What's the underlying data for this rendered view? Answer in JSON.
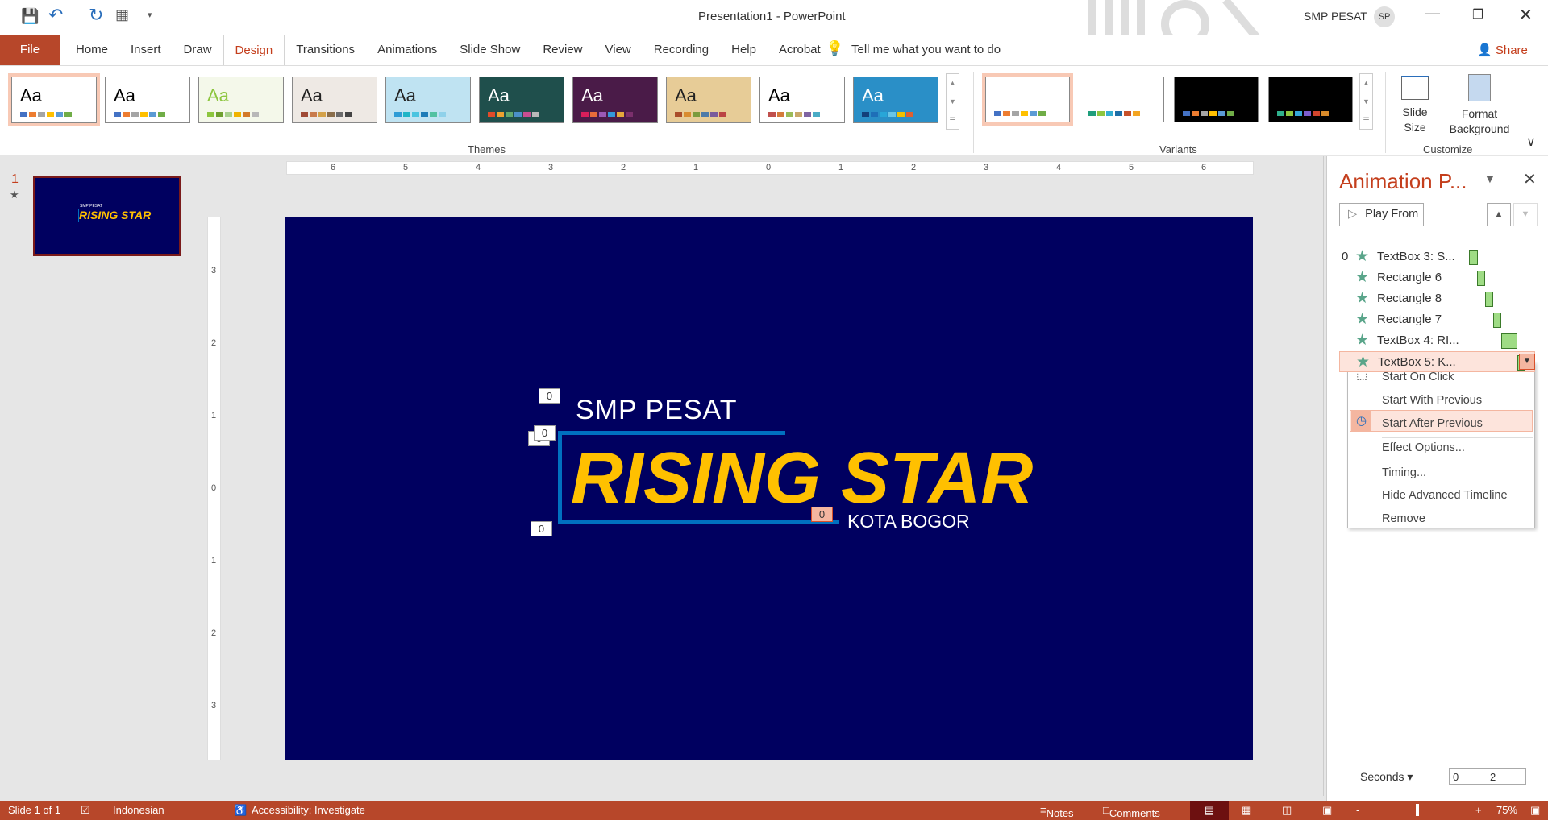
{
  "titlebar": {
    "title": "Presentation1  -  PowerPoint",
    "user": "SMP PESAT",
    "user_initials": "SP",
    "share": "Share"
  },
  "tabs": [
    "File",
    "Home",
    "Insert",
    "Draw",
    "Design",
    "Transitions",
    "Animations",
    "Slide Show",
    "Review",
    "View",
    "Recording",
    "Help",
    "Acrobat"
  ],
  "active_tab": "Design",
  "tell_me": "Tell me what you want to do",
  "ribbon": {
    "themes_label": "Themes",
    "variants_label": "Variants",
    "customize_label": "Customize",
    "theme_sample": "Aa",
    "slide_size": "Slide Size",
    "format_background": "Format Background"
  },
  "themes": [
    {
      "bg": "#ffffff",
      "fg": "#000",
      "sw": [
        "#4472c4",
        "#ed7d31",
        "#a5a5a5",
        "#ffc000",
        "#5b9bd5",
        "#70ad47"
      ]
    },
    {
      "bg": "#ffffff",
      "fg": "#000",
      "sw": [
        "#4472c4",
        "#ed7d31",
        "#a5a5a5",
        "#ffc000",
        "#5b9bd5",
        "#70ad47"
      ]
    },
    {
      "bg": "#f4f8ea",
      "fg": "#8dc63f",
      "sw": [
        "#8dc63f",
        "#6fa030",
        "#a8d08d",
        "#f0b400",
        "#d37a2a",
        "#b8b8b8"
      ]
    },
    {
      "bg": "#eee9e4",
      "fg": "#222",
      "sw": [
        "#a04a36",
        "#c97b4d",
        "#d4a24a",
        "#8a6e4b",
        "#6b6b6b",
        "#444"
      ]
    },
    {
      "bg": "#bfe3f2",
      "fg": "#222",
      "sw": [
        "#2e9cd6",
        "#1fb5c7",
        "#4cc4e0",
        "#1e7cb8",
        "#53c1a2",
        "#8fd1ea"
      ]
    },
    {
      "bg": "#1f4f4c",
      "fg": "#fff",
      "sw": [
        "#e04b2a",
        "#f0a030",
        "#62a66e",
        "#4b8fc9",
        "#c84d91",
        "#b8b8b8"
      ]
    },
    {
      "bg": "#4a1b48",
      "fg": "#fff",
      "sw": [
        "#d81e5b",
        "#e86c3a",
        "#9b59b6",
        "#3498db",
        "#e5a93b",
        "#7b2f6c"
      ]
    },
    {
      "bg": "#e7cc97",
      "fg": "#222",
      "sw": [
        "#a94d2a",
        "#d98c2f",
        "#7b9b3d",
        "#4e7ba8",
        "#7a5b9c",
        "#b44"
      ]
    },
    {
      "bg": "#ffffff",
      "fg": "#000",
      "sw": [
        "#c0504d",
        "#d57b3b",
        "#9bbb59",
        "#c9a86a",
        "#8064a2",
        "#4bacc6"
      ]
    },
    {
      "bg": "#2a8fc7",
      "fg": "#fff",
      "sw": [
        "#133f7a",
        "#1e6fb8",
        "#28a6d8",
        "#69c4e6",
        "#f0c000",
        "#e06030"
      ]
    }
  ],
  "variants": [
    {
      "bg": "#ffffff",
      "sw": [
        "#4472c4",
        "#ed7d31",
        "#a5a5a5",
        "#ffc000",
        "#5b9bd5",
        "#70ad47"
      ]
    },
    {
      "bg": "#ffffff",
      "sw": [
        "#1f9e7c",
        "#8dc63f",
        "#34aed1",
        "#1e6fa8",
        "#c7512a",
        "#f4a522"
      ]
    },
    {
      "bg": "#000000",
      "sw": [
        "#4472c4",
        "#ed7d31",
        "#a5a5a5",
        "#ffc000",
        "#5b9bd5",
        "#70ad47"
      ]
    },
    {
      "bg": "#000000",
      "sw": [
        "#2fb08c",
        "#8dc63f",
        "#34a6d8",
        "#7a5ccc",
        "#d1452e",
        "#d88a2a"
      ]
    }
  ],
  "thumbnails": {
    "slide_number": "1",
    "smp": "SMP PESAT",
    "title": "RISING STAR"
  },
  "slide": {
    "subtitle_top": "SMP PESAT",
    "title": "RISING STAR",
    "subtitle_bottom": "KOTA BOGOR",
    "tag": "0",
    "bg": "#000060",
    "title_color": "#ffc000",
    "line_color": "#0070c0"
  },
  "ruler": {
    "h": [
      "6",
      "5",
      "4",
      "3",
      "2",
      "1",
      "0",
      "1",
      "2",
      "3",
      "4",
      "5",
      "6"
    ],
    "v": [
      "3",
      "2",
      "1",
      "0",
      "1",
      "2",
      "3"
    ]
  },
  "pane": {
    "title": "Animation P...",
    "play_from": "Play From",
    "items": [
      {
        "num": "0",
        "label": "TextBox 3: S..."
      },
      {
        "num": "",
        "label": "Rectangle 6"
      },
      {
        "num": "",
        "label": "Rectangle 8"
      },
      {
        "num": "",
        "label": "Rectangle 7"
      },
      {
        "num": "",
        "label": "TextBox 4: RI..."
      },
      {
        "num": "",
        "label": "TextBox 5: K..."
      }
    ],
    "menu": [
      "Start On Click",
      "Start With Previous",
      "Start After Previous",
      "Effect Options...",
      "Timing...",
      "Hide Advanced Timeline",
      "Remove"
    ],
    "seconds": "Seconds",
    "scale": [
      "0",
      "2"
    ]
  },
  "status": {
    "slide": "Slide 1 of 1",
    "language": "Indonesian",
    "accessibility": "Accessibility: Investigate",
    "notes": "Notes",
    "comments": "Comments",
    "zoom": "75%",
    "zoom_level": 75
  }
}
